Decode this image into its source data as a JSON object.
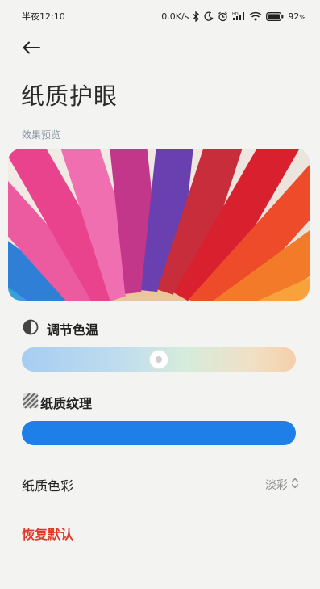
{
  "status_bar": {
    "time": "半夜12:10",
    "network_speed": "0.0K/s",
    "battery": "92",
    "battery_unit": "%",
    "icons": [
      "bluetooth-icon",
      "moon-icon",
      "alarm-icon",
      "hd-signal-icon",
      "wifi-icon",
      "battery-icon"
    ]
  },
  "header": {
    "back_icon": "arrow-left-icon",
    "title": "纸质护眼"
  },
  "preview": {
    "label": "效果预览",
    "image": "colored-pencils-image"
  },
  "color_temperature": {
    "icon": "half-circle-icon",
    "title": "调节色温",
    "level": 0.5
  },
  "paper_texture": {
    "icon": "hatched-square-icon",
    "title": "纸质纹理",
    "level": 1.0,
    "color": "#1e7fe8"
  },
  "paper_color": {
    "label": "纸质色彩",
    "value": "淡彩",
    "icon": "up-down-chevron-icon"
  },
  "reset": {
    "label": "恢复默认",
    "color": "#e0392b"
  }
}
